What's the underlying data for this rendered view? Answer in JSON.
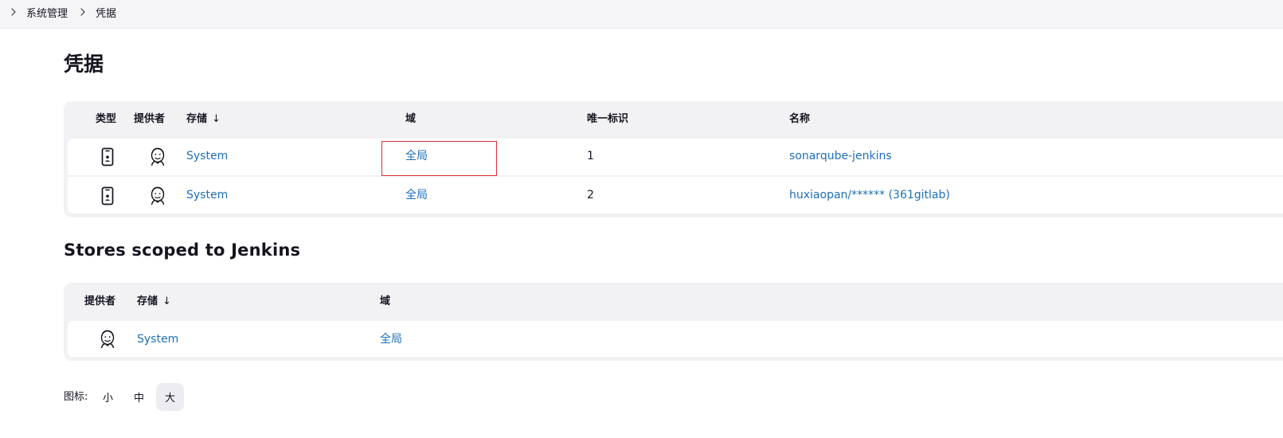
{
  "breadcrumb": {
    "items": [
      {
        "label": "系统管理"
      },
      {
        "label": "凭据"
      }
    ]
  },
  "page": {
    "title": "凭据"
  },
  "credentials_table": {
    "headers": {
      "type": "类型",
      "provider": "提供者",
      "store": "存储",
      "sort_arrow": "↓",
      "domain": "域",
      "id": "唯一标识",
      "name": "名称"
    },
    "rows": [
      {
        "type_icon": "mobile-credential-icon",
        "provider_icon": "jenkins-icon",
        "store": "System",
        "domain": "全局",
        "id": "1",
        "name": "sonarqube-jenkins"
      },
      {
        "type_icon": "mobile-credential-icon",
        "provider_icon": "jenkins-icon",
        "store": "System",
        "domain": "全局",
        "id": "2",
        "name": "huxiaopan/****** (361gitlab)"
      }
    ]
  },
  "stores_section": {
    "title": "Stores scoped to Jenkins"
  },
  "stores_table": {
    "headers": {
      "provider": "提供者",
      "store": "存储",
      "sort_arrow": "↓",
      "domain": "域"
    },
    "rows": [
      {
        "provider_icon": "jenkins-icon",
        "store": "System",
        "domain": "全局"
      }
    ]
  },
  "icon_size": {
    "label": "图标:",
    "options": [
      "小",
      "中",
      "大"
    ],
    "selected": "大"
  },
  "colors": {
    "link": "#1d6fba",
    "highlight": "#e03030",
    "panel_bg": "#f2f2f5"
  }
}
